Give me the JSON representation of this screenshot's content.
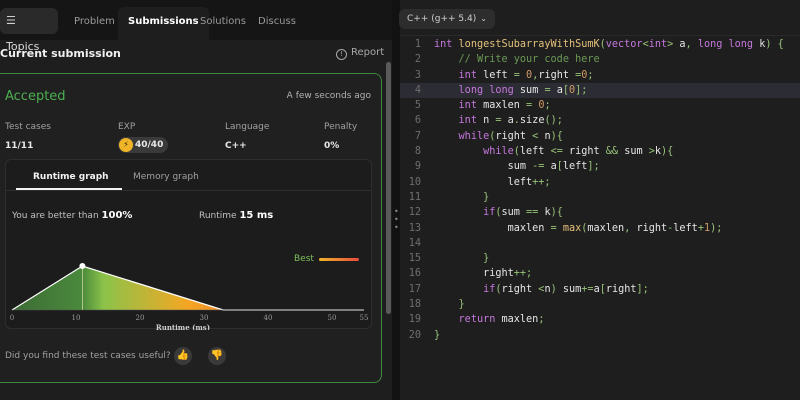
{
  "tabs": {
    "topics": "Topics",
    "problem": "Problem",
    "submissions": "Submissions",
    "solutions": "Solutions",
    "discuss": "Discuss"
  },
  "submission": {
    "title": "Current submission",
    "report": "Report",
    "status": "Accepted",
    "time": "A few seconds ago",
    "stats": {
      "test_cases_label": "Test cases",
      "test_cases_value": "11/11",
      "exp_label": "EXP",
      "exp_value": "40/40",
      "language_label": "Language",
      "language_value": "C++",
      "penalty_label": "Penalty",
      "penalty_value": "0%"
    }
  },
  "graph": {
    "tab_runtime": "Runtime graph",
    "tab_memory": "Memory graph",
    "better_prefix": "You are better than",
    "better_value": "100%",
    "runtime_prefix": "Runtime",
    "runtime_value": "15 ms",
    "best_label": "Best"
  },
  "chart_data": {
    "type": "area",
    "xlabel": "Runtime (ms)",
    "ylabel": "",
    "xlim": [
      0,
      55
    ],
    "x_ticks": [
      "0",
      "10",
      "20",
      "30",
      "40",
      "50",
      "55"
    ],
    "series": [
      {
        "x": [
          0,
          11,
          33,
          55
        ],
        "y": [
          0,
          1,
          0,
          0
        ]
      }
    ],
    "marker": {
      "x": 11,
      "y": 1
    },
    "colors": {
      "left": "#3d6b35",
      "mid": "#8bc34a",
      "peak": "#f5a623",
      "right": "#e74c3c"
    }
  },
  "feedback": {
    "question": "Did you find these test cases useful?"
  },
  "editor": {
    "language": "C++ (g++ 5.4)",
    "lines": [
      "int longestSubarrayWithSumK(vector<int> a, long long k) {",
      "    // Write your code here",
      "    int left = 0,right =0;",
      "    long long sum = a[0];",
      "    int maxlen = 0;",
      "    int n = a.size();",
      "    while(right < n){",
      "        while(left <= right && sum >k){",
      "            sum -= a[left];",
      "            left++;",
      "        }",
      "        if(sum == k){",
      "            maxlen = max(maxlen, right-left+1);",
      "",
      "        }",
      "        right++;",
      "        if(right <n) sum+=a[right];",
      "    }",
      "    return maxlen;",
      "}"
    ]
  }
}
